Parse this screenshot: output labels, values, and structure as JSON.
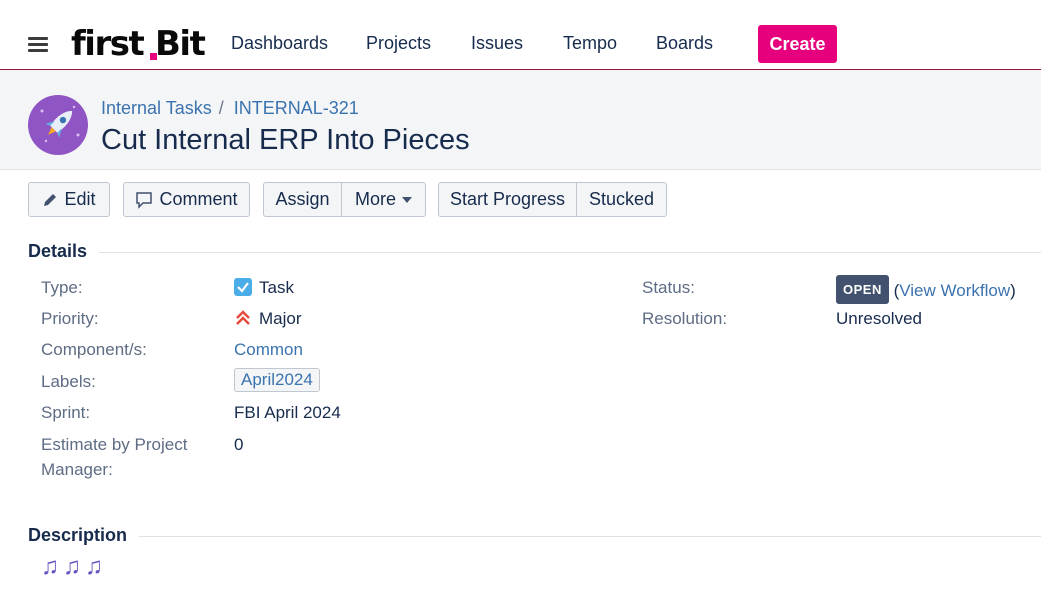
{
  "nav": {
    "logo": "firstBit",
    "items": [
      "Dashboards",
      "Projects",
      "Issues",
      "Tempo",
      "Boards"
    ],
    "create_label": "Create"
  },
  "issue": {
    "project": "Internal Tasks",
    "key": "INTERNAL-321",
    "title": "Cut Internal ERP Into Pieces"
  },
  "toolbar": {
    "edit": "Edit",
    "comment": "Comment",
    "assign": "Assign",
    "more": "More",
    "start_progress": "Start Progress",
    "stucked": "Stucked"
  },
  "details": {
    "heading": "Details",
    "type_label": "Type:",
    "type_value": "Task",
    "priority_label": "Priority:",
    "priority_value": "Major",
    "components_label": "Component/s:",
    "components_value": "Common",
    "labels_label": "Labels:",
    "labels_value": "April2024",
    "sprint_label": "Sprint:",
    "sprint_value": "FBI April 2024",
    "estimate_label_line1": "Estimate by Project",
    "estimate_label_line2": "Manager:",
    "estimate_value": "0",
    "status_label": "Status:",
    "status_value": "OPEN",
    "view_workflow": "View Workflow",
    "resolution_label": "Resolution:",
    "resolution_value": "Unresolved"
  },
  "description": {
    "heading": "Description",
    "content": "♫♫♫"
  },
  "colors": {
    "brand": "#e6007e",
    "link": "#3b73af",
    "lozenge": "#42526e",
    "avatar": "#8f55c4"
  }
}
